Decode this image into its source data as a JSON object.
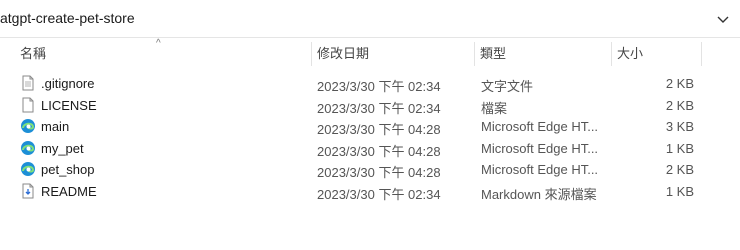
{
  "address": {
    "path": "atgpt-create-pet-store"
  },
  "columns": {
    "name": "名稱",
    "modified": "修改日期",
    "type": "類型",
    "size": "大小"
  },
  "files": [
    {
      "name": ".gitignore",
      "modified": "2023/3/30 下午 02:34",
      "type": "文字文件",
      "size": "2 KB",
      "icon": "text-file-icon"
    },
    {
      "name": "LICENSE",
      "modified": "2023/3/30 下午 02:34",
      "type": "檔案",
      "size": "2 KB",
      "icon": "blank-file-icon"
    },
    {
      "name": "main",
      "modified": "2023/3/30 下午 04:28",
      "type": "Microsoft Edge HT...",
      "size": "3 KB",
      "icon": "edge-icon"
    },
    {
      "name": "my_pet",
      "modified": "2023/3/30 下午 04:28",
      "type": "Microsoft Edge HT...",
      "size": "1 KB",
      "icon": "edge-icon"
    },
    {
      "name": "pet_shop",
      "modified": "2023/3/30 下午 04:28",
      "type": "Microsoft Edge HT...",
      "size": "2 KB",
      "icon": "edge-icon"
    },
    {
      "name": "README",
      "modified": "2023/3/30 下午 02:34",
      "type": "Markdown 來源檔案",
      "size": "1 KB",
      "icon": "markdown-file-icon"
    }
  ]
}
